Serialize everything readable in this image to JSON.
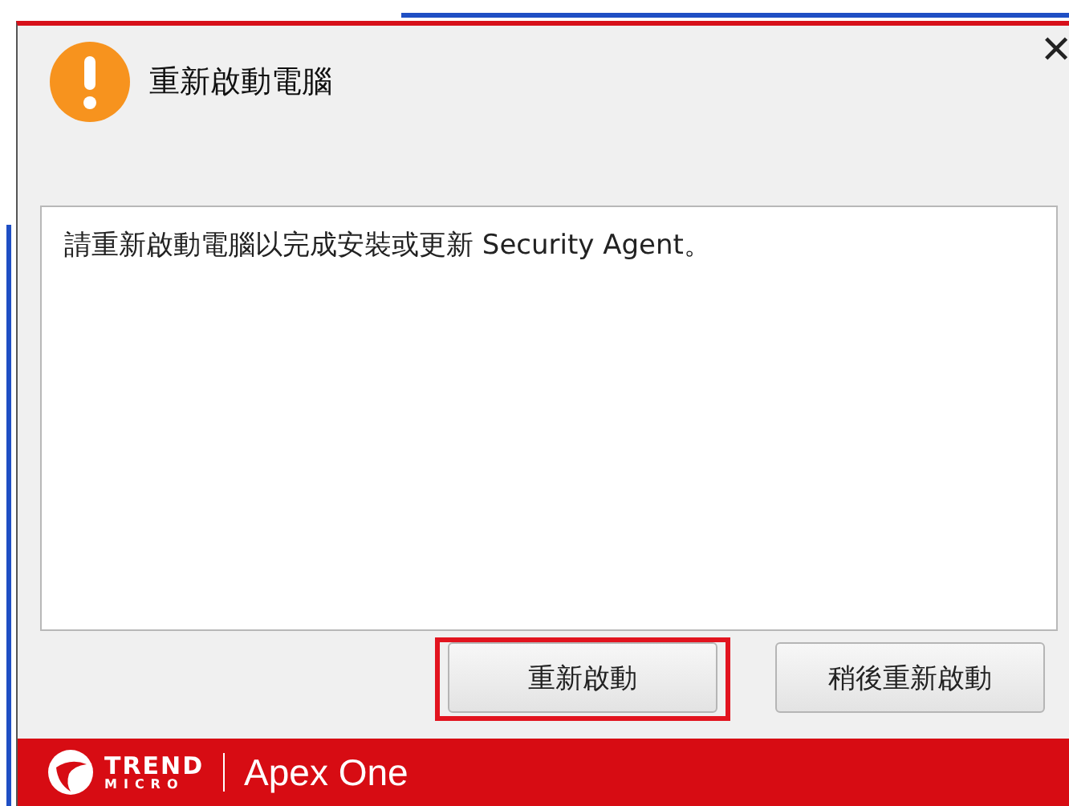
{
  "dialog": {
    "title": "重新啟動電腦",
    "close": "✕"
  },
  "message": "請重新啟動電腦以完成安裝或更新 Security Agent。",
  "buttons": [
    {
      "label": "重新啟動",
      "highlighted": true
    },
    {
      "label": "稍後重新啟動",
      "highlighted": false
    }
  ],
  "footer": {
    "brand_top": "TREND",
    "brand_bottom": "MICRO",
    "product": "Apex One"
  }
}
